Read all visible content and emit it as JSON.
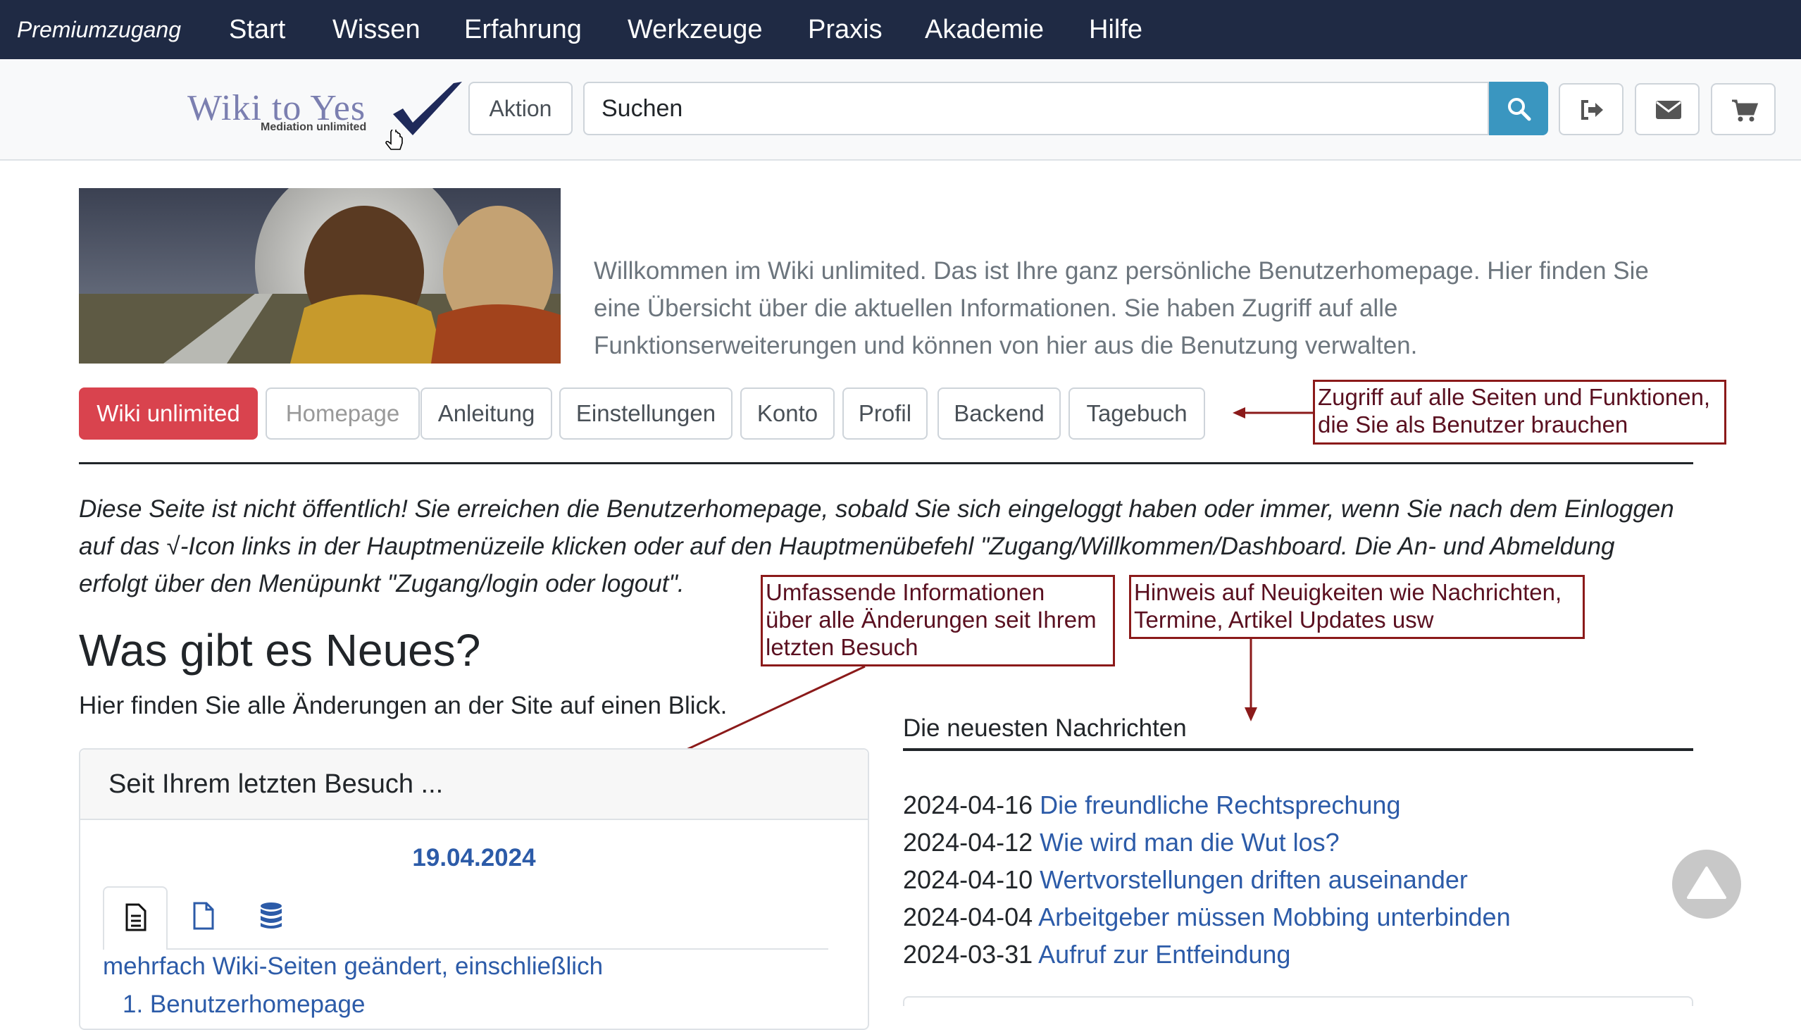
{
  "nav": {
    "brand": "Premiumzugang",
    "items": [
      "Start",
      "Wissen",
      "Erfahrung",
      "Werkzeuge",
      "Praxis",
      "Akademie",
      "Hilfe"
    ]
  },
  "header": {
    "logo_text": "Wiki to Yes",
    "logo_sub": "Mediation unlimited",
    "aktion_label": "Aktion",
    "search_placeholder": "Suchen",
    "icons": [
      "search-icon",
      "logout-icon",
      "envelope-icon",
      "cart-icon"
    ]
  },
  "welcome_text": "Willkommen im Wiki unlimited. Das ist Ihre ganz persönliche Benutzerhomepage. Hier finden Sie eine Übersicht über die aktuellen Informationen. Sie haben Zugriff auf alle Funktionserweiterungen und können von hier aus die Benutzung verwalten.",
  "tabs": [
    "Wiki unlimited",
    "Homepage",
    "Anleitung",
    "Einstellungen",
    "Konto",
    "Profil",
    "Backend",
    "Tagebuch"
  ],
  "annotations": {
    "tabs_note_1": "Zugriff auf alle Seiten und Funktionen,",
    "tabs_note_2": "die Sie als Benutzer brauchen",
    "changes_note_1": "Umfassende Informationen",
    "changes_note_2": "über alle Änderungen seit Ihrem",
    "changes_note_3": "letzten Besuch",
    "news_note_1": "Hinweis auf Neuigkeiten wie Nachrichten,",
    "news_note_2": "Termine, Artikel Updates usw"
  },
  "notice": {
    "line1": "Diese Seite ist nicht öffentlich! Sie erreichen die Benutzerhomepage, sobald Sie sich eingeloggt haben oder immer, wenn Sie nach dem Einloggen",
    "line2": "auf das √-Icon links in der Hauptmenüzeile klicken oder auf den Hauptmenübefehl \"Zugang/Willkommen/Dashboard. Die An- und Abmeldung",
    "line3": "erfolgt über den Menüpunkt \"Zugang/login oder logout\"."
  },
  "whats_new": {
    "title": "Was gibt es Neues?",
    "subtitle": "Hier finden Sie alle Änderungen an der Site auf einen Blick.",
    "card_title": "Seit Ihrem letzten Besuch ...",
    "date": "19.04.2024",
    "changes_link": "mehrfach Wiki-Seiten geändert, einschließlich",
    "first_item": "1. Benutzerhomepage"
  },
  "news": {
    "heading": "Die neuesten Nachrichten",
    "items": [
      {
        "date": "2024-04-16",
        "title": "Die freundliche Rechtsprechung"
      },
      {
        "date": "2024-04-12",
        "title": "Wie wird man die Wut los?"
      },
      {
        "date": "2024-04-10",
        "title": "Wertvorstellungen driften auseinander"
      },
      {
        "date": "2024-04-04",
        "title": "Arbeitgeber müssen Mobbing unterbinden"
      },
      {
        "date": "2024-03-31",
        "title": "Aufruf zur Entfeindung"
      }
    ]
  },
  "colors": {
    "nav_bg": "#1f2a44",
    "accent_red": "#d9434e",
    "search_blue": "#3a96c0",
    "link_blue": "#2c5ba8",
    "annotation_border": "#8b1a1a"
  }
}
